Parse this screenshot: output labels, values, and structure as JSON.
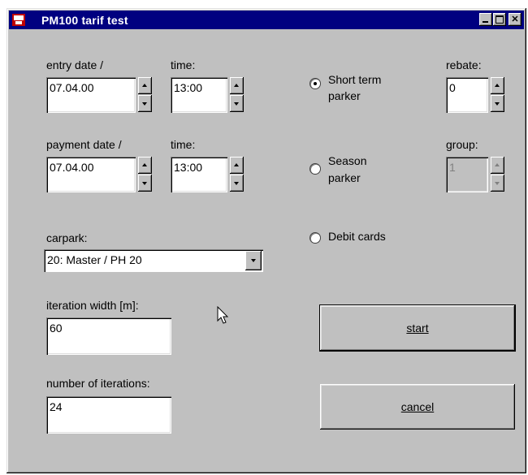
{
  "window": {
    "title": "PM100 tarif test"
  },
  "entry": {
    "date_label": "entry date /",
    "date_value": "07.04.00",
    "time_label": "time:",
    "time_value": "13:00"
  },
  "payment": {
    "date_label": "payment date /",
    "date_value": "07.04.00",
    "time_label": "time:",
    "time_value": "13:00"
  },
  "carpark": {
    "label": "carpark:",
    "selected": "20: Master  / PH 20"
  },
  "iteration_width": {
    "label": "iteration width [m]:",
    "value": "60"
  },
  "iterations": {
    "label": "number of iterations:",
    "value": "24"
  },
  "parker_type": {
    "options": [
      {
        "line1": "Short term",
        "line2": "parker",
        "checked": true
      },
      {
        "line1": "Season",
        "line2": "parker",
        "checked": false
      },
      {
        "line1": "Debit cards",
        "line2": "",
        "checked": false
      }
    ]
  },
  "rebate": {
    "label": "rebate:",
    "value": "0"
  },
  "group": {
    "label": "group:",
    "value": "1"
  },
  "buttons": {
    "start": "start",
    "cancel": "cancel"
  },
  "colors": {
    "titlebar": "#000080",
    "face": "#c0c0c0"
  }
}
